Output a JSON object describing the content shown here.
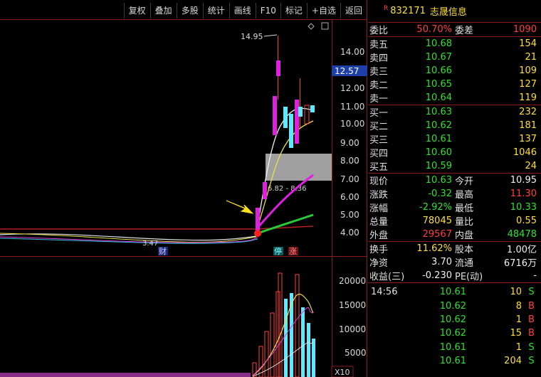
{
  "toolbar": [
    "复权",
    "叠加",
    "多股",
    "统计",
    "画线",
    "F10",
    "标记",
    "+自选",
    "返回"
  ],
  "chart": {
    "price_ticks": [
      "14.00",
      "12.00",
      "11.00",
      "10.00",
      "9.00",
      "8.00",
      "7.00",
      "6.00",
      "5.00",
      "4.00"
    ],
    "current_price_label": "12.57",
    "high_annotation": "14.95",
    "low_annotation": "3.47",
    "range_label": "6.82 - 8.36",
    "markers": {
      "cai": "财",
      "ting": "停",
      "zhang": "涨"
    },
    "volume_ticks": [
      "20000",
      "15000",
      "10000",
      "5000"
    ],
    "volume_unit": "X10"
  },
  "chart_data": {
    "type": "candlestick",
    "price_axis": [
      4,
      5,
      6,
      7,
      8,
      9,
      10,
      11,
      12,
      14
    ],
    "volume_axis": [
      5000,
      10000,
      15000,
      20000
    ]
  },
  "stock": {
    "flag": "R",
    "code": "832171",
    "name": "志晟信息"
  },
  "weibi": {
    "label1": "委比",
    "value1": "50.70%",
    "label2": "委差",
    "value2": "1090"
  },
  "asks": [
    {
      "label": "卖五",
      "price": "10.68",
      "vol": "154"
    },
    {
      "label": "卖四",
      "price": "10.67",
      "vol": "21"
    },
    {
      "label": "卖三",
      "price": "10.66",
      "vol": "109"
    },
    {
      "label": "卖二",
      "price": "10.65",
      "vol": "127"
    },
    {
      "label": "卖一",
      "price": "10.64",
      "vol": "119"
    }
  ],
  "bids": [
    {
      "label": "买一",
      "price": "10.63",
      "vol": "232"
    },
    {
      "label": "买二",
      "price": "10.62",
      "vol": "181"
    },
    {
      "label": "买三",
      "price": "10.61",
      "vol": "137"
    },
    {
      "label": "买四",
      "price": "10.60",
      "vol": "1046"
    },
    {
      "label": "买五",
      "price": "10.59",
      "vol": "24"
    }
  ],
  "quote": [
    {
      "l1": "现价",
      "v1": "10.63",
      "l2": "今开",
      "v2": "10.95"
    },
    {
      "l1": "涨跌",
      "v1": "-0.32",
      "l2": "最高",
      "v2": "11.30"
    },
    {
      "l1": "涨幅",
      "v1": "-2.92%",
      "l2": "最低",
      "v2": "10.33"
    },
    {
      "l1": "总量",
      "v1": "78045",
      "l2": "量比",
      "v2": "0.55"
    },
    {
      "l1": "外盘",
      "v1": "29567",
      "l2": "内盘",
      "v2": "48478"
    }
  ],
  "fundamentals": [
    {
      "l1": "换手",
      "v1": "11.62%",
      "l2": "股本",
      "v2": "1.00亿"
    },
    {
      "l1": "净资",
      "v1": "3.70",
      "l2": "流通",
      "v2": "6716万"
    },
    {
      "l1": "收益(三)",
      "v1": "-0.230",
      "l2": "PE(动)",
      "v2": "-"
    }
  ],
  "ticks": [
    {
      "time": "14:56",
      "price": "10.61",
      "vol": "10",
      "side": "S"
    },
    {
      "time": "",
      "price": "10.62",
      "vol": "8",
      "side": "B"
    },
    {
      "time": "",
      "price": "10.62",
      "vol": "1",
      "side": "B"
    },
    {
      "time": "",
      "price": "10.62",
      "vol": "15",
      "side": "B"
    },
    {
      "time": "",
      "price": "10.61",
      "vol": "1",
      "side": "S"
    },
    {
      "time": "",
      "price": "10.61",
      "vol": "204",
      "side": "S"
    }
  ]
}
